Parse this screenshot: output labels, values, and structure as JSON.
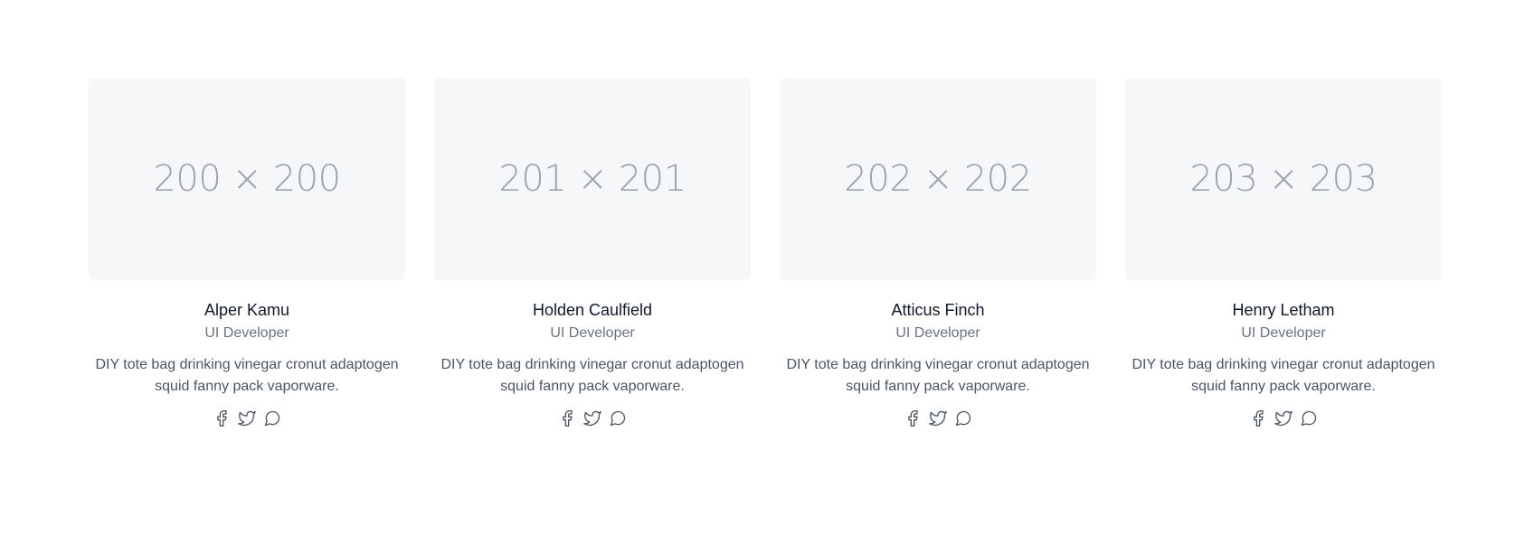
{
  "team": {
    "members": [
      {
        "photo_label": "200 × 200",
        "name": "Alper Kamu",
        "role": "UI Developer",
        "bio": "DIY tote bag drinking vinegar cronut adaptogen squid fanny pack vaporware.",
        "socials": [
          "facebook-icon",
          "twitter-icon",
          "chat-icon"
        ]
      },
      {
        "photo_label": "201 × 201",
        "name": "Holden Caulfield",
        "role": "UI Developer",
        "bio": "DIY tote bag drinking vinegar cronut adaptogen squid fanny pack vaporware.",
        "socials": [
          "facebook-icon",
          "twitter-icon",
          "chat-icon"
        ]
      },
      {
        "photo_label": "202 × 202",
        "name": "Atticus Finch",
        "role": "UI Developer",
        "bio": "DIY tote bag drinking vinegar cronut adaptogen squid fanny pack vaporware.",
        "socials": [
          "facebook-icon",
          "twitter-icon",
          "chat-icon"
        ]
      },
      {
        "photo_label": "203 × 203",
        "name": "Henry Letham",
        "role": "UI Developer",
        "bio": "DIY tote bag drinking vinegar cronut adaptogen squid fanny pack vaporware.",
        "socials": [
          "facebook-icon",
          "twitter-icon",
          "chat-icon"
        ]
      }
    ]
  },
  "colors": {
    "photo_bg": "#f6f7f9",
    "photo_text": "#9ea3ad",
    "name": "#111827",
    "role": "#6b7280",
    "bio": "#4b5563",
    "icon": "#4b5563"
  }
}
